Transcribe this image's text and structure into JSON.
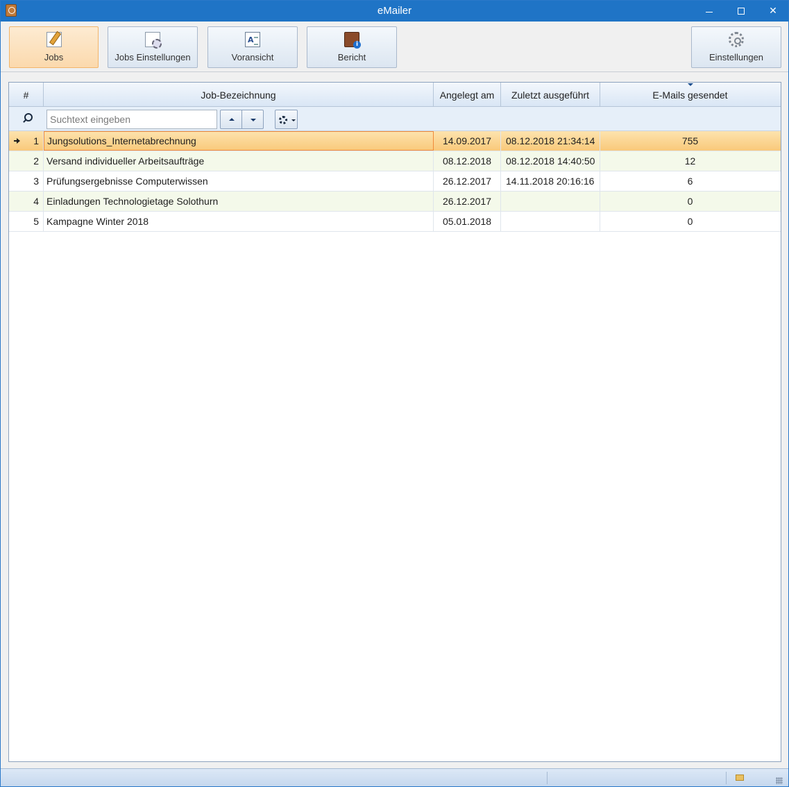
{
  "window": {
    "title": "eMailer",
    "controls": {
      "minimize": "minimize",
      "maximize": "maximize",
      "close": "✕"
    }
  },
  "toolbar": {
    "buttons": [
      {
        "label": "Jobs",
        "icon": "edit-document-icon",
        "active": true
      },
      {
        "label": "Jobs Einstellungen",
        "icon": "document-gear-icon",
        "active": false
      },
      {
        "label": "Voransicht",
        "icon": "preview-icon",
        "active": false
      },
      {
        "label": "Bericht",
        "icon": "report-icon",
        "active": false
      }
    ],
    "settings": {
      "label": "Einstellungen",
      "icon": "gear-icon"
    }
  },
  "grid": {
    "columns": [
      "#",
      "Job-Bezeichnung",
      "Angelegt am",
      "Zuletzt ausgeführt",
      "E-Mails gesendet"
    ],
    "sorted_column": "E-Mails gesendet",
    "search": {
      "placeholder": "Suchtext eingeben",
      "value": ""
    },
    "rows": [
      {
        "num": "1",
        "name": "Jungsolutions_Internetabrechnung",
        "created": "14.09.2017",
        "last_run": "08.12.2018 21:34:14",
        "sent": "755",
        "selected": true
      },
      {
        "num": "2",
        "name": "Versand individueller Arbeitsaufträge",
        "created": "08.12.2018",
        "last_run": "08.12.2018 14:40:50",
        "sent": "12"
      },
      {
        "num": "3",
        "name": "Prüfungsergebnisse Computerwissen",
        "created": "26.12.2017",
        "last_run": "14.11.2018 20:16:16",
        "sent": "6"
      },
      {
        "num": "4",
        "name": "Einladungen Technologietage Solothurn",
        "created": "26.12.2017",
        "last_run": "",
        "sent": "0"
      },
      {
        "num": "5",
        "name": "Kampagne Winter 2018",
        "created": "05.01.2018",
        "last_run": "",
        "sent": "0"
      }
    ]
  },
  "colors": {
    "titlebar": "#1f74c6",
    "selected_row": "#f9c97a",
    "alt_row": "#f4f9ea",
    "active_button_border": "#f2b56a"
  }
}
